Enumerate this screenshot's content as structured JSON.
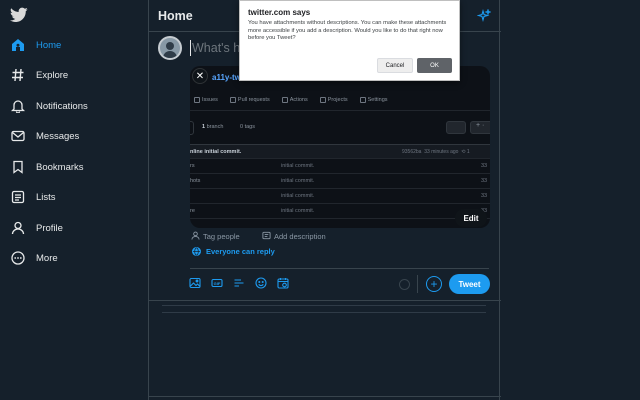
{
  "sidebar": {
    "logo_icon": "twitter-bird-icon",
    "items": [
      {
        "label": "Home",
        "icon": "home-icon",
        "active": true
      },
      {
        "label": "Explore",
        "icon": "hashtag-icon"
      },
      {
        "label": "Notifications",
        "icon": "bell-icon"
      },
      {
        "label": "Messages",
        "icon": "envelope-icon"
      },
      {
        "label": "Bookmarks",
        "icon": "bookmark-icon"
      },
      {
        "label": "Lists",
        "icon": "list-icon"
      },
      {
        "label": "Profile",
        "icon": "person-icon"
      },
      {
        "label": "More",
        "icon": "more-circle-icon"
      }
    ]
  },
  "header": {
    "title": "Home",
    "sparkle_icon": "sparkle-icon"
  },
  "composer": {
    "placeholder": "What's happening?",
    "attachment": {
      "repo_name": "a11y-tw",
      "tabs": [
        "Issues",
        "Pull requests",
        "Actions",
        "Projects",
        "Settings"
      ],
      "branch_count": "1",
      "branch_label": "branch",
      "tags_label": "0 tags",
      "commit_message": "nline initial commit.",
      "commit_hash": "93562ba",
      "commit_time": "33 minutes ago",
      "commit_count": "1",
      "files": [
        {
          "name": "rs",
          "commit": "initial commit.",
          "age": "33"
        },
        {
          "name": "hots",
          "commit": "initial commit.",
          "age": "33"
        },
        {
          "name": "",
          "commit": "initial commit.",
          "age": "33"
        },
        {
          "name": "re",
          "commit": "initial commit.",
          "age": "33"
        }
      ]
    },
    "edit_label": "Edit",
    "tag_people": "Tag people",
    "add_description": "Add description",
    "reply_setting": "Everyone can reply",
    "tools": [
      "image-icon",
      "gif-icon",
      "poll-icon",
      "emoji-icon",
      "schedule-icon"
    ],
    "tweet_label": "Tweet"
  },
  "dialog": {
    "title": "twitter.com says",
    "message": "You have attachments without descriptions. You can make these attachments more accessible if you add a description. Would you like to do that right now before you Tweet?",
    "cancel_label": "Cancel",
    "ok_label": "OK"
  },
  "colors": {
    "accent": "#1d9bf0",
    "background": "#15202b",
    "border": "#38444d"
  }
}
